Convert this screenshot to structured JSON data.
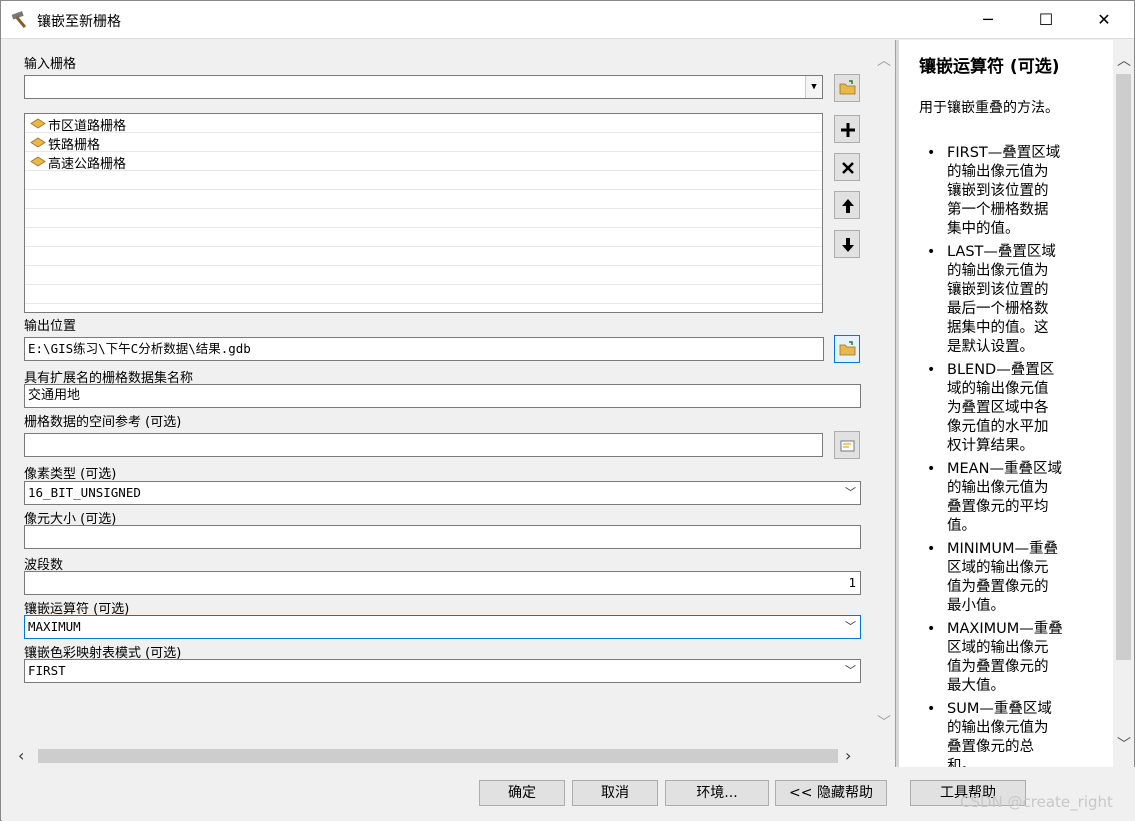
{
  "window": {
    "title": "镶嵌至新栅格",
    "minimize": "─",
    "maximize": "☐",
    "close": "✕"
  },
  "form": {
    "input_rasters": {
      "label": "输入栅格",
      "value": "",
      "items": [
        "市区道路栅格",
        "铁路栅格",
        "高速公路栅格"
      ]
    },
    "output_location": {
      "label": "输出位置",
      "value": "E:\\GIS练习\\下午C分析数据\\结果.gdb"
    },
    "dataset_name": {
      "label": "具有扩展名的栅格数据集名称",
      "value": "交通用地"
    },
    "spatial_ref": {
      "label": "栅格数据的空间参考 (可选)",
      "value": ""
    },
    "pixel_type": {
      "label": "像素类型 (可选)",
      "value": "16_BIT_UNSIGNED"
    },
    "cellsize": {
      "label": "像元大小 (可选)",
      "value": ""
    },
    "num_bands": {
      "label": "波段数",
      "value": "1"
    },
    "mosaic_operator": {
      "label": "镶嵌运算符 (可选)",
      "value": "MAXIMUM"
    },
    "colormap_mode": {
      "label": "镶嵌色彩映射表模式 (可选)",
      "value": "FIRST"
    }
  },
  "help": {
    "title": "镶嵌运算符 (可选)",
    "description": "用于镶嵌重叠的方法。",
    "items": [
      {
        "line1": "FIRST—叠置区域",
        "line2": "的输出像元值为",
        "line3": "镶嵌到该位置的",
        "line4": "第一个栅格数据",
        "line5": "集中的值。"
      },
      {
        "line1": "LAST—叠置区域",
        "line2": "的输出像元值为",
        "line3": "镶嵌到该位置的",
        "line4": "最后一个栅格数",
        "line5": "据集中的值。这",
        "line6": "是默认设置。"
      },
      {
        "line1": "BLEND—叠置区",
        "line2": "域的输出像元值",
        "line3": "为叠置区域中各",
        "line4": "像元值的水平加",
        "line5": "权计算结果。"
      },
      {
        "line1": "MEAN—重叠区域",
        "line2": "的输出像元值为",
        "line3": "叠置像元的平均",
        "line4": "值。"
      },
      {
        "line1": "MINIMUM—重叠",
        "line2": "区域的输出像元",
        "line3": "值为叠置像元的",
        "line4": "最小值。"
      },
      {
        "line1": "MAXIMUM—重叠",
        "line2": "区域的输出像元",
        "line3": "值为叠置像元的",
        "line4": "最大值。"
      },
      {
        "line1": "SUM—重叠区域",
        "line2": "的输出像元值为",
        "line3": "叠置像元的总",
        "line4": "和。"
      }
    ]
  },
  "buttons": {
    "ok": "确定",
    "cancel": "取消",
    "environments": "环境...",
    "hide_help": "<< 隐藏帮助",
    "tool_help": "工具帮助"
  },
  "watermark": "CSDN @create_right",
  "colors": {
    "accent": "#0078d7",
    "folder": "#e8b84a"
  }
}
